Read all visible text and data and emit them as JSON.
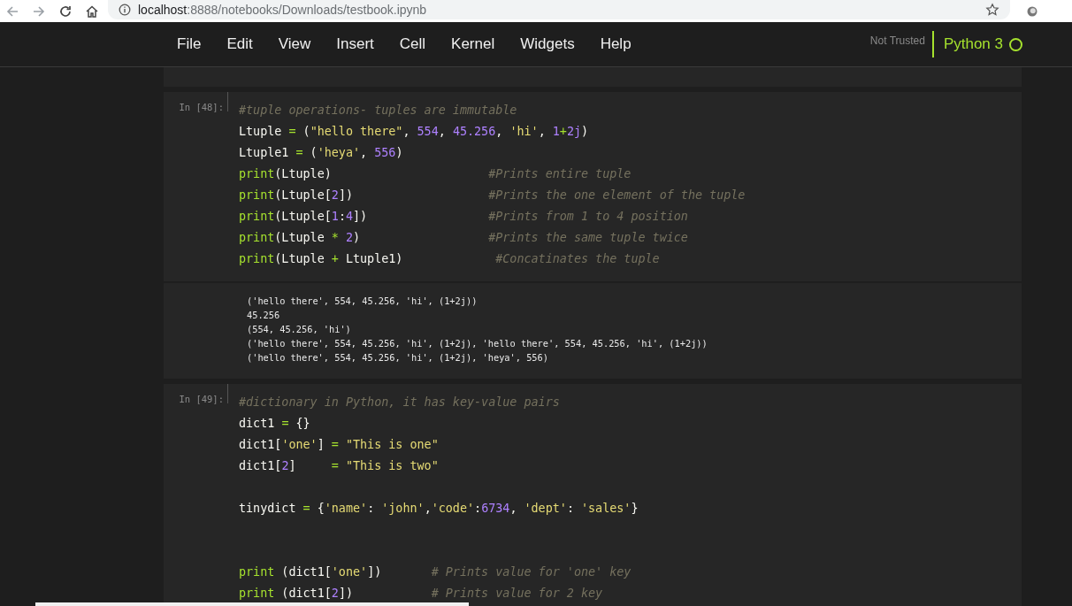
{
  "browser": {
    "url_host": "localhost",
    "url_path": ":8888/notebooks/Downloads/testbook.ipynb"
  },
  "menu": [
    "File",
    "Edit",
    "View",
    "Insert",
    "Cell",
    "Kernel",
    "Widgets",
    "Help"
  ],
  "kernel": {
    "trust": "Not Trusted",
    "name": "Python 3",
    "busy": false
  },
  "cells": [
    {
      "prompt": "In [48]:",
      "lines": [
        {
          "kind": "code",
          "tokens": [
            {
              "kind": "comment",
              "text": "#tuple operations- tuples are immutable"
            }
          ]
        },
        {
          "kind": "code",
          "tokens": [
            {
              "kind": "plain",
              "text": "Ltuple "
            },
            {
              "kind": "op",
              "text": "="
            },
            {
              "kind": "plain",
              "text": " ("
            },
            {
              "kind": "str",
              "text": "\"hello there\""
            },
            {
              "kind": "plain",
              "text": ", "
            },
            {
              "kind": "num",
              "text": "554"
            },
            {
              "kind": "plain",
              "text": ", "
            },
            {
              "kind": "num",
              "text": "45.256"
            },
            {
              "kind": "plain",
              "text": ", "
            },
            {
              "kind": "str",
              "text": "'hi'"
            },
            {
              "kind": "plain",
              "text": ", "
            },
            {
              "kind": "num",
              "text": "1"
            },
            {
              "kind": "op",
              "text": "+"
            },
            {
              "kind": "num",
              "text": "2j"
            },
            {
              "kind": "plain",
              "text": ")"
            }
          ]
        },
        {
          "kind": "code",
          "tokens": [
            {
              "kind": "plain",
              "text": "Ltuple1 "
            },
            {
              "kind": "op",
              "text": "="
            },
            {
              "kind": "plain",
              "text": " ("
            },
            {
              "kind": "str",
              "text": "'heya'"
            },
            {
              "kind": "plain",
              "text": ", "
            },
            {
              "kind": "num",
              "text": "556"
            },
            {
              "kind": "plain",
              "text": ")"
            }
          ]
        },
        {
          "kind": "code",
          "tokens": [
            {
              "kind": "builtin",
              "text": "print"
            },
            {
              "kind": "plain",
              "text": "(Ltuple)                      "
            },
            {
              "kind": "comment",
              "text": "#Prints entire tuple"
            }
          ]
        },
        {
          "kind": "code",
          "tokens": [
            {
              "kind": "builtin",
              "text": "print"
            },
            {
              "kind": "plain",
              "text": "(Ltuple["
            },
            {
              "kind": "num",
              "text": "2"
            },
            {
              "kind": "plain",
              "text": "])                   "
            },
            {
              "kind": "comment",
              "text": "#Prints the one element of the tuple"
            }
          ]
        },
        {
          "kind": "code",
          "tokens": [
            {
              "kind": "builtin",
              "text": "print"
            },
            {
              "kind": "plain",
              "text": "(Ltuple["
            },
            {
              "kind": "num",
              "text": "1"
            },
            {
              "kind": "plain",
              "text": ":"
            },
            {
              "kind": "num",
              "text": "4"
            },
            {
              "kind": "plain",
              "text": "])                 "
            },
            {
              "kind": "comment",
              "text": "#Prints from 1 to 4 position"
            }
          ]
        },
        {
          "kind": "code",
          "tokens": [
            {
              "kind": "builtin",
              "text": "print"
            },
            {
              "kind": "plain",
              "text": "(Ltuple "
            },
            {
              "kind": "op",
              "text": "* "
            },
            {
              "kind": "num",
              "text": "2"
            },
            {
              "kind": "plain",
              "text": ")                  "
            },
            {
              "kind": "comment",
              "text": "#Prints the same tuple twice"
            }
          ]
        },
        {
          "kind": "code",
          "tokens": [
            {
              "kind": "builtin",
              "text": "print"
            },
            {
              "kind": "plain",
              "text": "(Ltuple "
            },
            {
              "kind": "op",
              "text": "+"
            },
            {
              "kind": "plain",
              "text": " Ltuple1)             "
            },
            {
              "kind": "comment",
              "text": "#Concatinates the tuple"
            }
          ]
        }
      ],
      "output": [
        "('hello there', 554, 45.256, 'hi', (1+2j))",
        "45.256",
        "(554, 45.256, 'hi')",
        "('hello there', 554, 45.256, 'hi', (1+2j), 'hello there', 554, 45.256, 'hi', (1+2j))",
        "('hello there', 554, 45.256, 'hi', (1+2j), 'heya', 556)"
      ]
    },
    {
      "prompt": "In [49]:",
      "lines": [
        {
          "kind": "code",
          "tokens": [
            {
              "kind": "comment",
              "text": "#dictionary in Python, it has key-value pairs"
            }
          ]
        },
        {
          "kind": "code",
          "tokens": [
            {
              "kind": "plain",
              "text": "dict1 "
            },
            {
              "kind": "op",
              "text": "="
            },
            {
              "kind": "plain",
              "text": " {}"
            }
          ]
        },
        {
          "kind": "code",
          "tokens": [
            {
              "kind": "plain",
              "text": "dict1["
            },
            {
              "kind": "str",
              "text": "'one'"
            },
            {
              "kind": "plain",
              "text": "] "
            },
            {
              "kind": "op",
              "text": "= "
            },
            {
              "kind": "str",
              "text": "\"This is one\""
            }
          ]
        },
        {
          "kind": "code",
          "tokens": [
            {
              "kind": "plain",
              "text": "dict1["
            },
            {
              "kind": "num",
              "text": "2"
            },
            {
              "kind": "plain",
              "text": "]     "
            },
            {
              "kind": "op",
              "text": "= "
            },
            {
              "kind": "str",
              "text": "\"This is two\""
            }
          ]
        },
        {
          "kind": "blank"
        },
        {
          "kind": "code",
          "tokens": [
            {
              "kind": "plain",
              "text": "tinydict "
            },
            {
              "kind": "op",
              "text": "="
            },
            {
              "kind": "plain",
              "text": " {"
            },
            {
              "kind": "str",
              "text": "'name'"
            },
            {
              "kind": "plain",
              "text": ": "
            },
            {
              "kind": "str",
              "text": "'john'"
            },
            {
              "kind": "plain",
              "text": ","
            },
            {
              "kind": "str",
              "text": "'code'"
            },
            {
              "kind": "plain",
              "text": ":"
            },
            {
              "kind": "num",
              "text": "6734"
            },
            {
              "kind": "plain",
              "text": ", "
            },
            {
              "kind": "str",
              "text": "'dept'"
            },
            {
              "kind": "plain",
              "text": ": "
            },
            {
              "kind": "str",
              "text": "'sales'"
            },
            {
              "kind": "plain",
              "text": "}"
            }
          ]
        },
        {
          "kind": "blank"
        },
        {
          "kind": "blank"
        },
        {
          "kind": "code",
          "tokens": [
            {
              "kind": "builtin",
              "text": "print"
            },
            {
              "kind": "plain",
              "text": " (dict1["
            },
            {
              "kind": "str",
              "text": "'one'"
            },
            {
              "kind": "plain",
              "text": "])       "
            },
            {
              "kind": "comment",
              "text": "# Prints value for 'one' key"
            }
          ]
        },
        {
          "kind": "code",
          "tokens": [
            {
              "kind": "builtin",
              "text": "print"
            },
            {
              "kind": "plain",
              "text": " (dict1["
            },
            {
              "kind": "num",
              "text": "2"
            },
            {
              "kind": "plain",
              "text": "])           "
            },
            {
              "kind": "comment",
              "text": "# Prints value for 2 key"
            }
          ]
        }
      ]
    }
  ]
}
